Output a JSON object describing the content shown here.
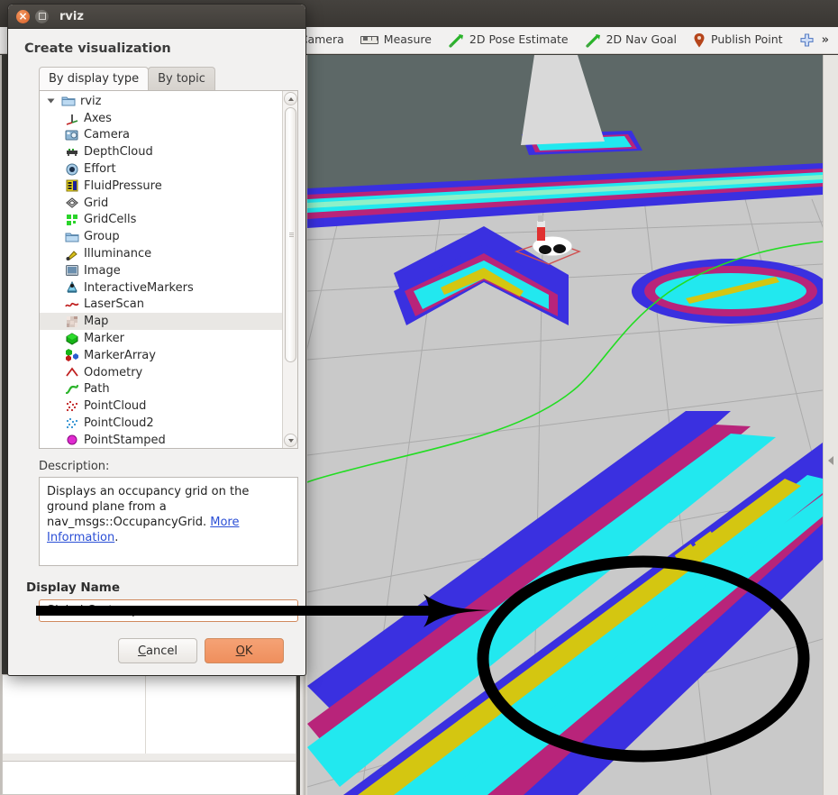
{
  "window": {
    "app_title": "rviz",
    "close_icon": "close-icon",
    "maximize_icon": "maximize-icon"
  },
  "toolbar": {
    "items": [
      {
        "label": "s Camera",
        "icon": "camera-icon",
        "truncated": true
      },
      {
        "label": "Measure",
        "icon": "ruler-icon"
      },
      {
        "label": "2D Pose Estimate",
        "icon": "green-arrow-icon"
      },
      {
        "label": "2D Nav Goal",
        "icon": "green-arrow-icon"
      },
      {
        "label": "Publish Point",
        "icon": "map-pin-icon"
      },
      {
        "label": "",
        "icon": "plus-crosshair-icon"
      }
    ],
    "overflow_label": "»"
  },
  "dialog": {
    "heading": "Create visualization",
    "tabs": [
      {
        "label": "By display type",
        "active": true
      },
      {
        "label": "By topic",
        "active": false
      }
    ],
    "tree": {
      "root": {
        "label": "rviz",
        "icon": "folder-icon",
        "expanded": true
      },
      "items": [
        {
          "label": "Axes",
          "icon": "axes-icon"
        },
        {
          "label": "Camera",
          "icon": "camera-icon"
        },
        {
          "label": "DepthCloud",
          "icon": "depthcloud-icon"
        },
        {
          "label": "Effort",
          "icon": "effort-icon"
        },
        {
          "label": "FluidPressure",
          "icon": "fluidpressure-icon"
        },
        {
          "label": "Grid",
          "icon": "grid-icon"
        },
        {
          "label": "GridCells",
          "icon": "gridcells-icon"
        },
        {
          "label": "Group",
          "icon": "folder-icon"
        },
        {
          "label": "Illuminance",
          "icon": "illuminance-icon"
        },
        {
          "label": "Image",
          "icon": "image-icon"
        },
        {
          "label": "InteractiveMarkers",
          "icon": "interactivemarkers-icon"
        },
        {
          "label": "LaserScan",
          "icon": "laserscan-icon"
        },
        {
          "label": "Map",
          "icon": "map-icon",
          "selected": true
        },
        {
          "label": "Marker",
          "icon": "marker-icon"
        },
        {
          "label": "MarkerArray",
          "icon": "markerarray-icon"
        },
        {
          "label": "Odometry",
          "icon": "odometry-icon"
        },
        {
          "label": "Path",
          "icon": "path-icon"
        },
        {
          "label": "PointCloud",
          "icon": "pointcloud-icon"
        },
        {
          "label": "PointCloud2",
          "icon": "pointcloud2-icon"
        },
        {
          "label": "PointStamped",
          "icon": "pointstamped-icon"
        }
      ]
    },
    "description": {
      "label": "Description:",
      "text_before_link": "Displays an occupancy grid on the ground plane from a nav_msgs::OccupancyGrid. ",
      "link_text": "More Information",
      "text_after_link": "."
    },
    "display_name": {
      "label": "Display Name",
      "value": "Global Costmap",
      "placeholder": ""
    },
    "buttons": {
      "cancel": {
        "mnemonic": "C",
        "rest": "ancel"
      },
      "ok": {
        "mnemonic": "O",
        "rest": "K"
      }
    }
  },
  "colors": {
    "accent_orange": "#ef8f5d",
    "field_border": "#d08a5e",
    "titlebar": "#413e3a",
    "sky": "#5d6867",
    "ground": "#c9c9c9",
    "costmap_cyan": "#22e8ef",
    "costmap_blue": "#3a30e0",
    "costmap_magenta": "#b8247a",
    "costmap_yellow": "#d4c611",
    "path_green": "#22dd22"
  },
  "annotations": {
    "arrow": "black-arrow-annotation",
    "ellipse": "black-ellipse-annotation"
  }
}
